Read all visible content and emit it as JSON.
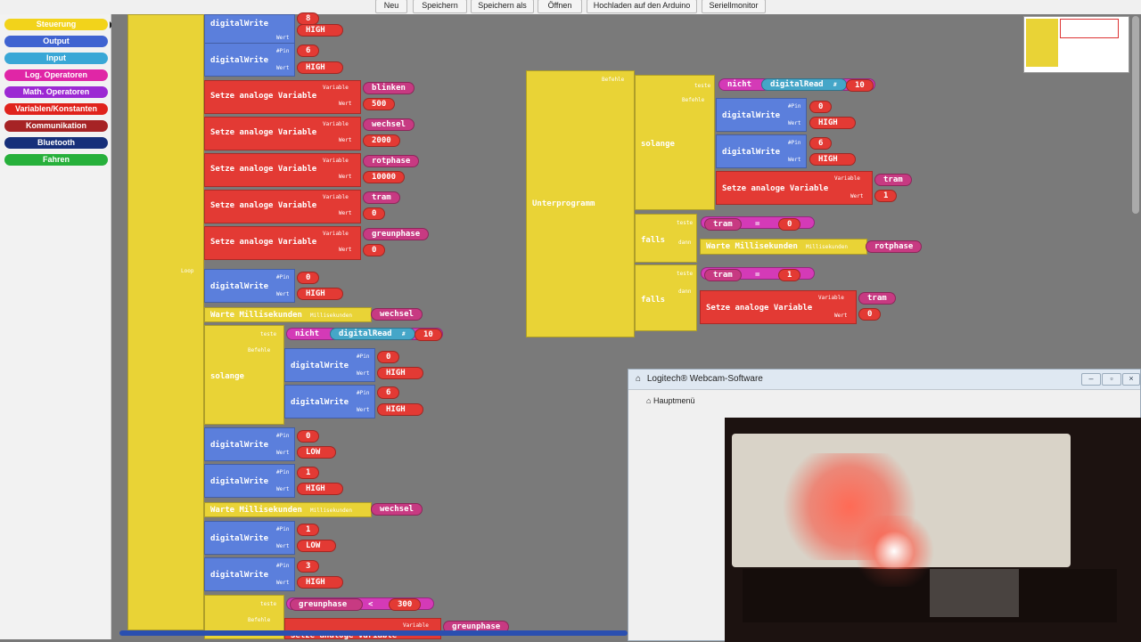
{
  "toolbar": {
    "buttons": [
      "Neu",
      "Speichern",
      "Speichern als",
      "Öffnen",
      "Hochladen auf den Arduino",
      "Seriellmonitor"
    ]
  },
  "palette": {
    "categories": [
      {
        "label": "Steuerung",
        "color": "#f2d31b"
      },
      {
        "label": "Output",
        "color": "#3f63d1"
      },
      {
        "label": "Input",
        "color": "#39a7d6"
      },
      {
        "label": "Log. Operatoren",
        "color": "#e026a6"
      },
      {
        "label": "Math. Operatoren",
        "color": "#9c29d3"
      },
      {
        "label": "Variablen/Konstanten",
        "color": "#e0231c"
      },
      {
        "label": "Kommunikation",
        "color": "#a62325"
      },
      {
        "label": "Bluetooth",
        "color": "#17307a"
      },
      {
        "label": "Fahren",
        "color": "#27b03b"
      }
    ]
  },
  "labels": {
    "digitalWrite": "digitalWrite",
    "pin": "#Pin",
    "wert": "Wert",
    "setze": "Setze analoge Variable",
    "variable": "Variable",
    "warte": "Warte Millisekunden",
    "millis": "Millisekunden",
    "solange": "solange",
    "teste": "teste",
    "befehle": "Befehle",
    "nicht": "nicht",
    "digitalRead": "digitalRead",
    "hash": "#",
    "falls": "falls",
    "dann": "dann",
    "loop": "Loop",
    "unterprogramm": "Unterprogramm",
    "eq": "=",
    "lt": "<"
  },
  "left_blocks": {
    "dw1": {
      "pin": "8",
      "val": "HIGH"
    },
    "dw2": {
      "pin": "6",
      "val": "HIGH"
    },
    "setvars": [
      {
        "var": "blinken",
        "val": "500"
      },
      {
        "var": "wechsel",
        "val": "2000"
      },
      {
        "var": "rotphase",
        "val": "10000"
      },
      {
        "var": "tram",
        "val": "0"
      },
      {
        "var": "greunphase",
        "val": "0"
      }
    ],
    "loop_dw": {
      "pin": "0",
      "val": "HIGH"
    },
    "loop_wait": "wechsel",
    "while_read": "10",
    "while_dw1": {
      "pin": "0",
      "val": "HIGH"
    },
    "while_dw2": {
      "pin": "6",
      "val": "HIGH"
    },
    "after_dw1": {
      "pin": "0",
      "val": "LOW"
    },
    "after_dw2": {
      "pin": "1",
      "val": "HIGH"
    },
    "wait2": "wechsel",
    "after_dw3": {
      "pin": "1",
      "val": "LOW"
    },
    "after_dw4": {
      "pin": "3",
      "val": "HIGH"
    },
    "cond": {
      "var": "greunphase",
      "val": "300"
    },
    "last_set_var": "greunphase",
    "last_set_label": "Setze analoge Variable"
  },
  "right_blocks": {
    "while_read": "10",
    "dw1": {
      "pin": "0",
      "val": "HIGH"
    },
    "dw2": {
      "pin": "6",
      "val": "HIGH"
    },
    "set1": {
      "var": "tram",
      "val": "1"
    },
    "if1": {
      "var": "tram",
      "val": "0",
      "wait_var": "rotphase"
    },
    "if2": {
      "var": "tram",
      "val": "1",
      "set_var": "tram",
      "set_val": "0"
    }
  },
  "webcam": {
    "title": "Logitech® Webcam-Software",
    "menu": "Hauptmenü"
  }
}
